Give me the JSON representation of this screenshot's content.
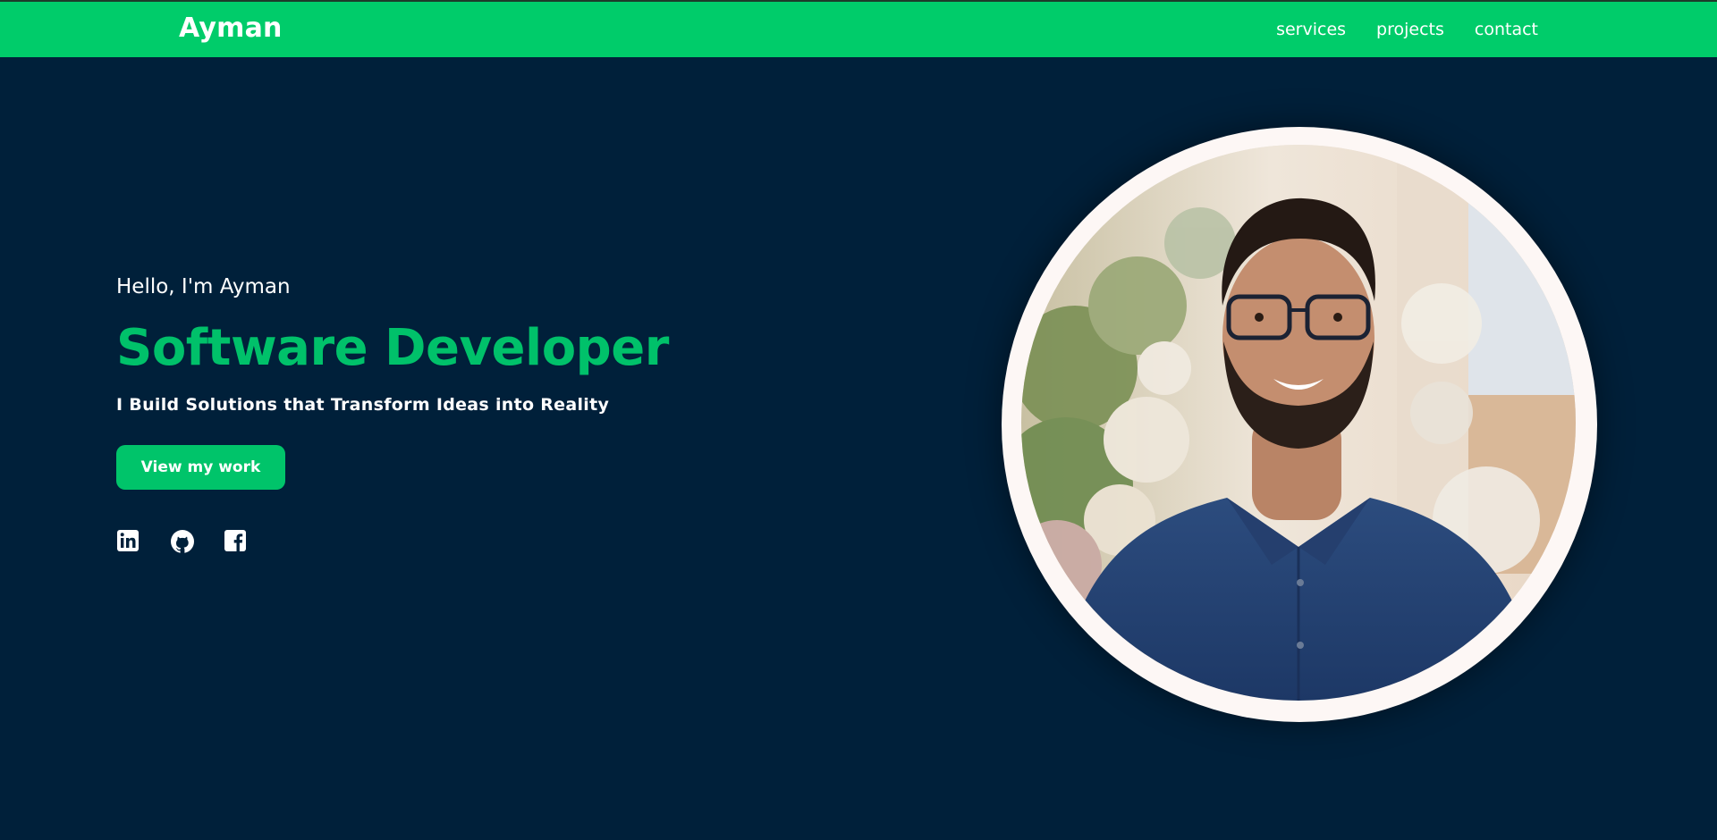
{
  "header": {
    "brand": "Ayman",
    "nav": [
      {
        "label": "services"
      },
      {
        "label": "projects"
      },
      {
        "label": "contact"
      }
    ]
  },
  "hero": {
    "greeting": "Hello, I'm Ayman",
    "role": "Software Developer",
    "tagline": "I Build Solutions that Transform Ideas into Reality",
    "cta_label": "View my work",
    "socials": [
      {
        "icon": "linkedin-icon"
      },
      {
        "icon": "github-icon"
      },
      {
        "icon": "facebook-icon"
      }
    ]
  },
  "colors": {
    "background": "#00203a",
    "accent": "#00cc6a",
    "text": "#ffffff",
    "portrait_ring": "#fdf7f5"
  }
}
